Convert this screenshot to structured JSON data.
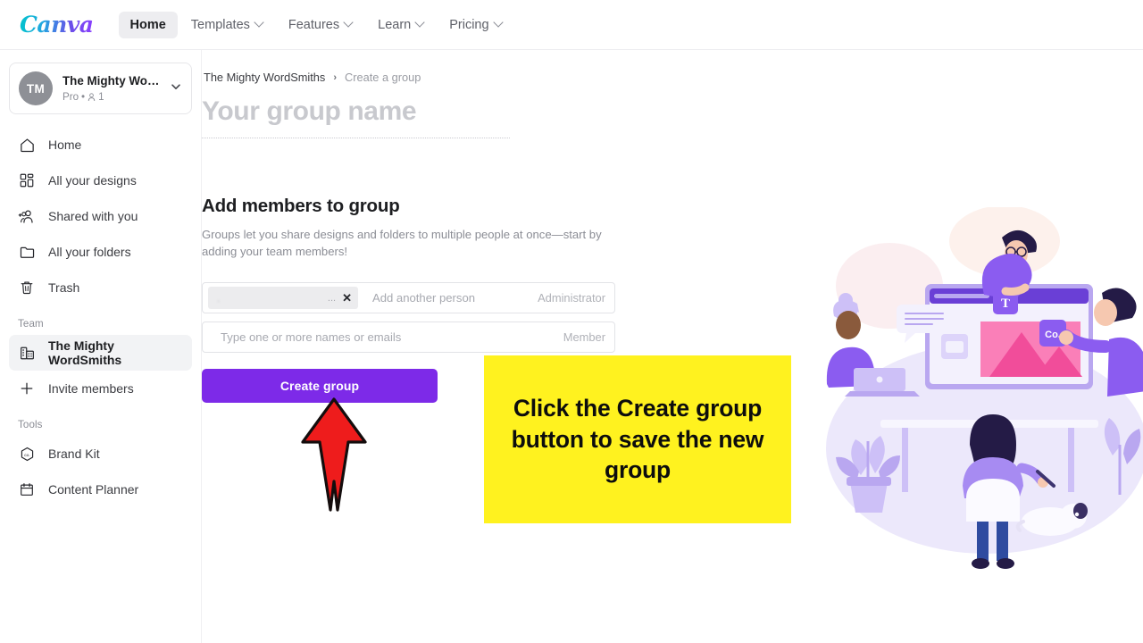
{
  "topnav": {
    "logo_text": "Canva",
    "items": [
      {
        "label": "Home",
        "has_chevron": false,
        "active": true
      },
      {
        "label": "Templates",
        "has_chevron": true,
        "active": false
      },
      {
        "label": "Features",
        "has_chevron": true,
        "active": false
      },
      {
        "label": "Learn",
        "has_chevron": true,
        "active": false
      },
      {
        "label": "Pricing",
        "has_chevron": true,
        "active": false
      }
    ]
  },
  "sidebar": {
    "account": {
      "avatar_initials": "TM",
      "name": "The Mighty WordS...",
      "plan": "Pro",
      "separator": "•",
      "member_count": "1"
    },
    "items": [
      {
        "label": "Home",
        "icon": "home-icon"
      },
      {
        "label": "All your designs",
        "icon": "grid-icon"
      },
      {
        "label": "Shared with you",
        "icon": "shared-people-icon"
      },
      {
        "label": "All your folders",
        "icon": "folder-icon"
      },
      {
        "label": "Trash",
        "icon": "trash-icon"
      }
    ],
    "team_section_label": "Team",
    "team_items": [
      {
        "label": "The Mighty WordSmiths",
        "icon": "team-building-icon",
        "active": true
      },
      {
        "label": "Invite members",
        "icon": "plus-icon",
        "active": false
      }
    ],
    "tools_section_label": "Tools",
    "tools_items": [
      {
        "label": "Brand Kit",
        "icon": "brand-kit-icon"
      },
      {
        "label": "Content Planner",
        "icon": "calendar-icon"
      }
    ]
  },
  "main": {
    "breadcrumb": {
      "parent": "The Mighty WordSmiths",
      "separator": "›",
      "current": "Create a group"
    },
    "group_name_placeholder": "Your group name",
    "group_name_value": "",
    "section_title": "Add members to group",
    "section_description": "Groups let you share designs and folders to multiple people at once—start by adding your team members!",
    "member_rows": [
      {
        "chip_name": ".",
        "chip_truncation": "...",
        "chip_remove_label": "✕",
        "input_placeholder": "Add another person",
        "role": "Administrator"
      },
      {
        "chip_name": null,
        "input_placeholder": "Type one or more names or emails",
        "role": "Member"
      }
    ],
    "create_button_label": "Create group"
  },
  "annotation": {
    "callout_text": "Click the Create group button to save the new group",
    "callout_bg": "#fff21f",
    "callout_text_color": "#0d0d0d",
    "arrow_color": "#ee1c1c",
    "arrow_direction": "up"
  },
  "colors": {
    "brand_purple": "#7d2ae8",
    "nav_active_bg": "#ededf0",
    "sidebar_active_bg": "#f2f3f5",
    "muted_text": "#8b8d95",
    "body_text": "#1d1e21"
  }
}
